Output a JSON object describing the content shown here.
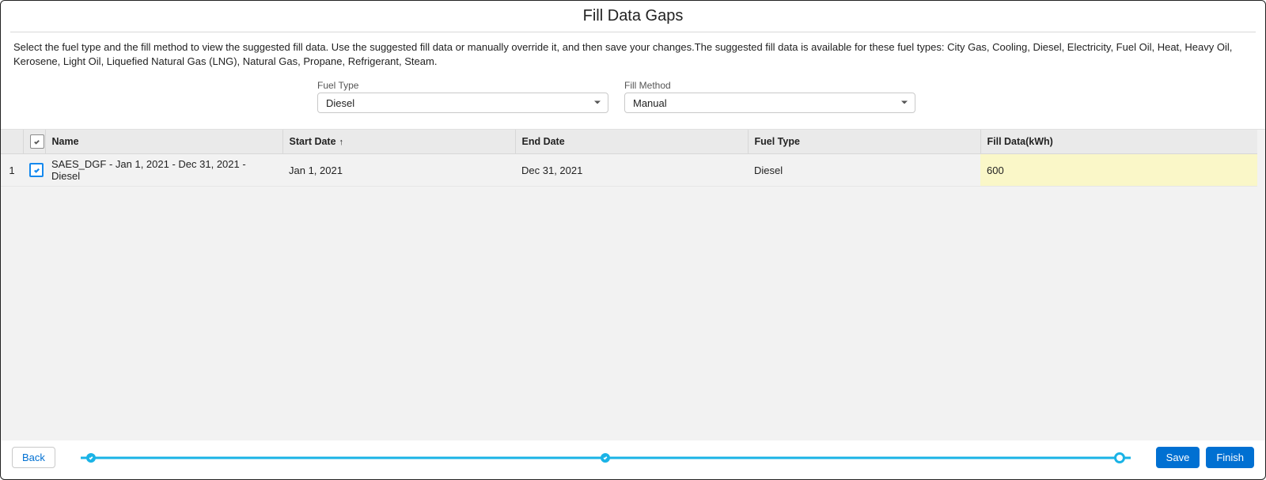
{
  "title": "Fill Data Gaps",
  "description": "Select the fuel type and the fill method to view the suggested fill data. Use the suggested fill data or manually override it, and then save your changes.The suggested fill data is available for these fuel types: City Gas, Cooling, Diesel, Electricity, Fuel Oil, Heat, Heavy Oil, Kerosene, Light Oil, Liquefied Natural Gas (LNG), Natural Gas, Propane, Refrigerant, Steam.",
  "filters": {
    "fuel_type": {
      "label": "Fuel Type",
      "value": "Diesel"
    },
    "fill_method": {
      "label": "Fill Method",
      "value": "Manual"
    }
  },
  "table": {
    "columns": {
      "name": "Name",
      "start_date": "Start Date",
      "end_date": "End Date",
      "fuel_type": "Fuel Type",
      "fill_data": "Fill Data(kWh)"
    },
    "sort_indicator": "↑",
    "rows": [
      {
        "index": "1",
        "checked": true,
        "name": "SAES_DGF - Jan 1, 2021 - Dec 31, 2021 - Diesel",
        "start_date": "Jan 1, 2021",
        "end_date": "Dec 31, 2021",
        "fuel_type": "Diesel",
        "fill_data": "600"
      }
    ]
  },
  "footer": {
    "back": "Back",
    "save": "Save",
    "finish": "Finish"
  }
}
